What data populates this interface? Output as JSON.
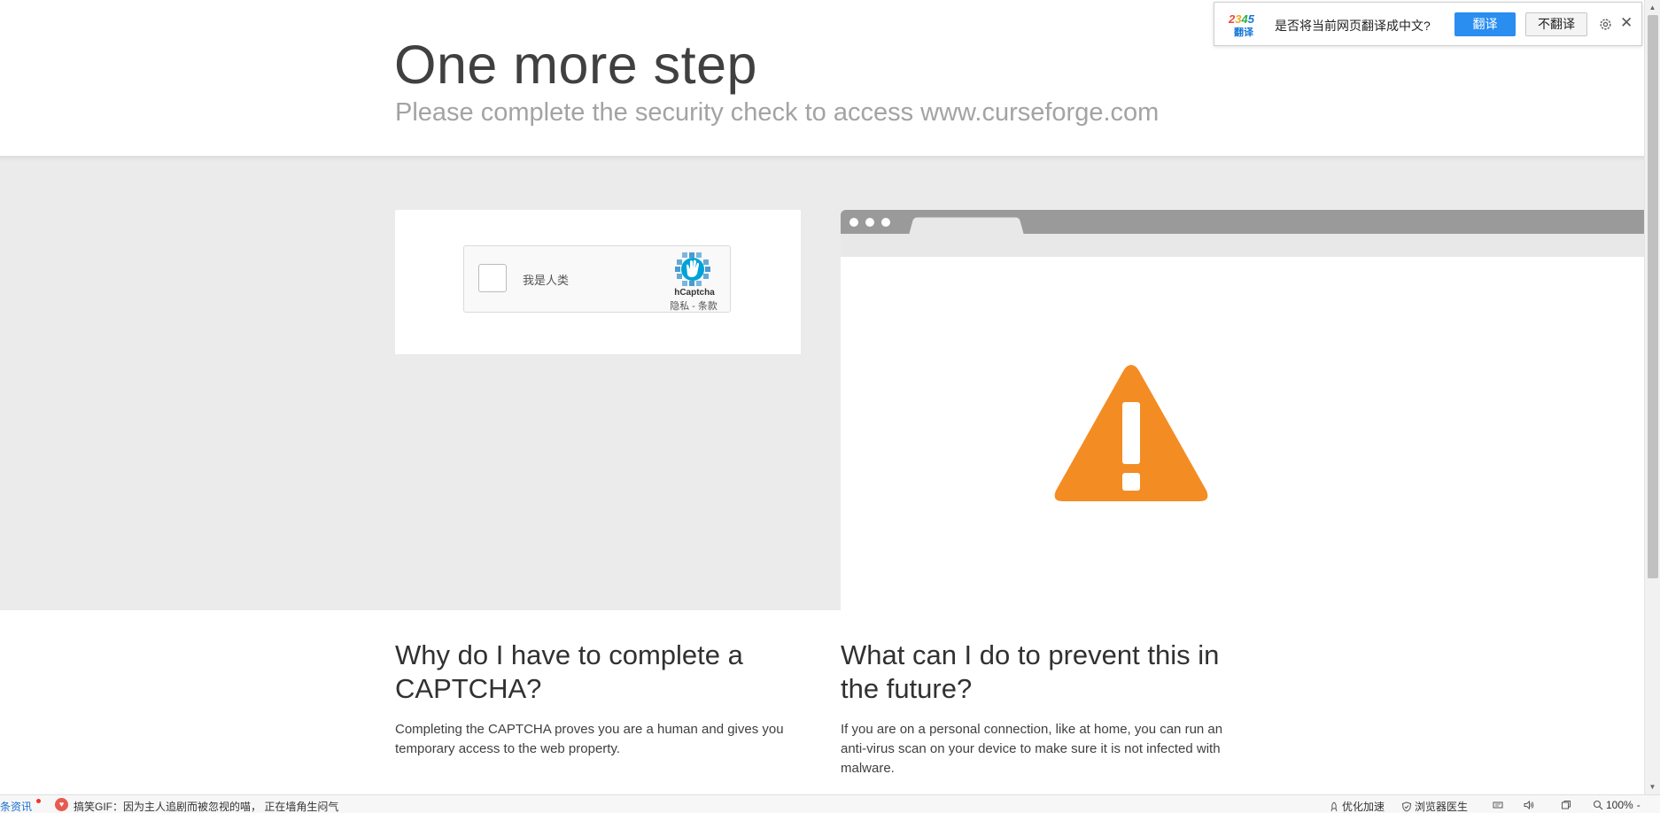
{
  "header": {
    "title": "One more step",
    "subtitle": "Please complete the security check to access www.curseforge.com"
  },
  "captcha": {
    "checkbox_label": "我是人类",
    "brand": "hCaptcha",
    "privacy_link": "隐私",
    "separator": " - ",
    "terms_link": "条款"
  },
  "sections": {
    "why": {
      "title": "Why do I have to complete a CAPTCHA?",
      "text": "Completing the CAPTCHA proves you are a human and gives you temporary access to the web property."
    },
    "prevent": {
      "title": "What can I do to prevent this in the future?",
      "text": "If you are on a personal connection, like at home, you can run an anti-virus scan on your device to make sure it is not infected with malware."
    }
  },
  "translate_bar": {
    "logo_number": "2345",
    "logo_label": "翻译",
    "question": "是否将当前网页翻译成中文?",
    "translate_button": "翻译",
    "no_translate_button": "不翻译"
  },
  "status_bar": {
    "news_label": "条资讯",
    "gif_headline": "搞笑GIF：因为主人追剧而被忽视的喵，  正在墙角生闷气",
    "optimize_label": "优化加速",
    "doctor_label": "浏览器医生",
    "zoom_label": "100%"
  },
  "colors": {
    "warning_orange": "#f48c24",
    "band_gray": "#ebebeb",
    "translate_blue": "#2a8ef0"
  }
}
